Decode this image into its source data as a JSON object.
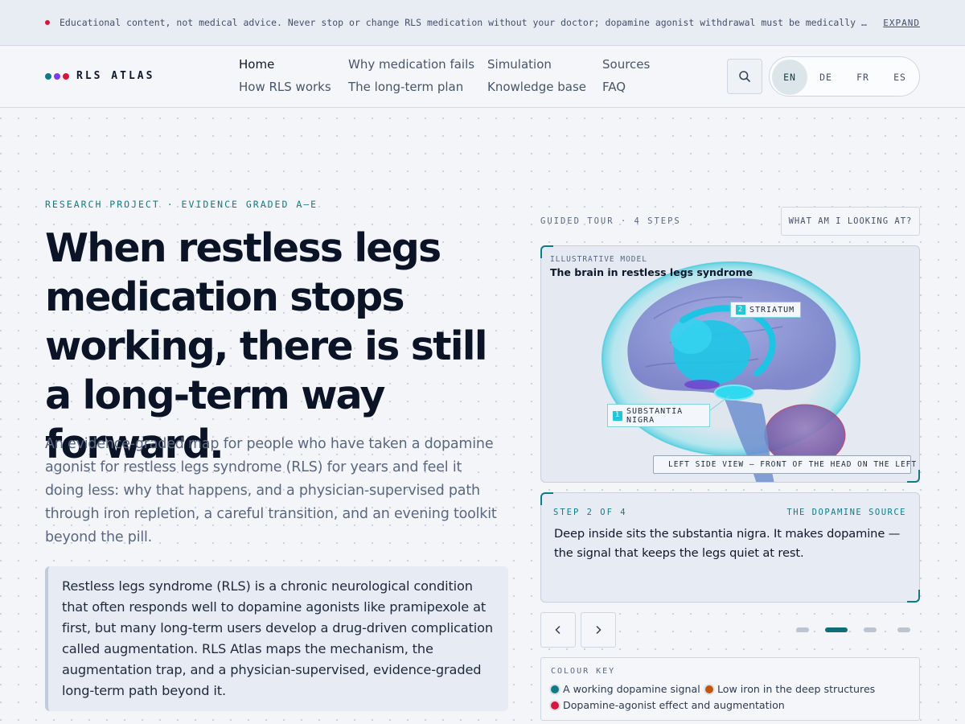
{
  "notice": {
    "text": "Educational content, not medical advice. Never stop or change RLS medication without your doctor; dopamine agonist withdrawal must be medically supervised.",
    "expand_label": "EXPAND"
  },
  "brand": {
    "name": "RLS ATLAS",
    "dots": [
      "#0e7c86",
      "#7c3aed",
      "#d6163d"
    ]
  },
  "nav": {
    "items": [
      {
        "label": "Home",
        "active": true
      },
      {
        "label": "How RLS works"
      },
      {
        "label": "Why medication fails"
      },
      {
        "label": "The long-term plan"
      },
      {
        "label": "Simulation"
      },
      {
        "label": "Knowledge base"
      },
      {
        "label": "Sources"
      },
      {
        "label": "FAQ"
      }
    ],
    "search_icon": "search-icon"
  },
  "languages": {
    "options": [
      "EN",
      "DE",
      "FR",
      "ES"
    ],
    "selected": "EN"
  },
  "hero": {
    "eyebrow": "RESEARCH PROJECT · EVIDENCE GRADED A–E",
    "title": "When restless legs medication stops working, there is still a long-term way forward.",
    "lede": "An evidence-graded map for people who have taken a dopamine agonist for restless legs syndrome (RLS) for years and feel it doing less: why that happens, and a physician-supervised path through iron repletion, a careful transition, and an evening toolkit beyond the pill.",
    "callout": "Restless legs syndrome (RLS) is a chronic neurological condition that often responds well to dopamine agonists like pramipexole at first, but many long-term users develop a drug-driven complication called augmentation. RLS Atlas maps the mechanism, the augmentation trap, and a physician-supervised, evidence-graded long-term path beyond it."
  },
  "tour": {
    "label": "GUIDED TOUR · 4 STEPS",
    "help_button": "WHAT AM I LOOKING AT?",
    "viz_kicker": "ILLUSTRATIVE MODEL",
    "viz_title": "The brain in restless legs syndrome",
    "labels": [
      {
        "num": "2",
        "text": "STRIATUM"
      },
      {
        "num": "1",
        "text": "SUBSTANTIA NIGRA"
      }
    ],
    "view_note": "LEFT SIDE VIEW — FRONT OF THE HEAD ON THE LEFT",
    "step_counter": "STEP 2 OF 4",
    "step_tag": "THE DOPAMINE SOURCE",
    "step_text": "Deep inside sits the substantia nigra. It makes dopamine — the signal that keeps the legs quiet at rest.",
    "prev_icon": "chevron-left-icon",
    "next_icon": "chevron-right-icon",
    "current_step": 2,
    "total_steps": 4
  },
  "colour_key": {
    "title": "COLOUR KEY",
    "items": [
      {
        "label": "A working dopamine signal",
        "color": "#0e7c86"
      },
      {
        "label": "Low iron in the deep structures",
        "color": "#c2570c"
      },
      {
        "label": "Dopamine-agonist effect and augmentation",
        "color": "#d6163d"
      }
    ]
  }
}
